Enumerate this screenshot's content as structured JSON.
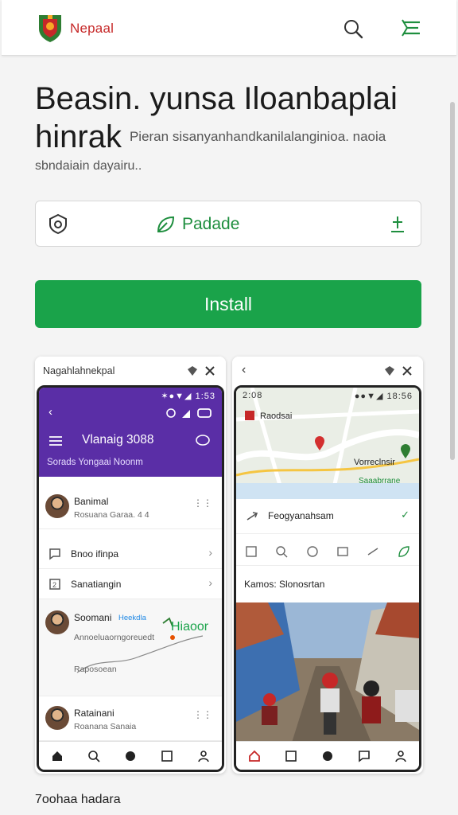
{
  "app": {
    "brand": "Nepaal",
    "logo_icon": "nepal-emblem-logo",
    "search_icon": "search-icon",
    "menu_icon": "menu-icon"
  },
  "heading": {
    "title_line1": "Beasin. yunsa Iloanbaplai",
    "title_line2": "hinrak",
    "inline_desc": "Pieran sisanyanhandkanilalanginioa. naoia",
    "subtitle": "sbndaiain dayairu.."
  },
  "update": {
    "label": "Padade",
    "left_icon": "shield-icon",
    "mid_icon": "leaf-icon",
    "right_icon": "download-icon"
  },
  "install": {
    "label": "Install"
  },
  "screenshots": [
    {
      "caption": "Nagahlahnekpal",
      "status": "✶●▼◢ 1:53",
      "header_title": "Vlanaig 3088",
      "tabs": "Sorads   Yongaai Noonm",
      "rows": [
        {
          "name": "Banimal",
          "sub": "Rosuana Garaa. 4 4"
        },
        {
          "name": "Bnoo ifinpa",
          "sub": ""
        },
        {
          "name": "Sanatiangin",
          "sub": ""
        },
        {
          "name": "Soomani",
          "sub": "Heekdla",
          "sub2": "Annoeluaorngoreuedt",
          "route_label": "Hiaoor",
          "sub3": "Raposoean"
        },
        {
          "name": "Ratainani",
          "sub": "Roanana Sanaia"
        }
      ]
    },
    {
      "caption": "",
      "status": "2:08",
      "status_r": "●●▼◢ 18:56",
      "map_label_1": "Raodsai",
      "map_label_2": "Vorreclnsir",
      "map_label_3": "Saaabrrane",
      "row1": "Feogyanahsam",
      "row2": "Kamos: Slonosrtan"
    }
  ],
  "footer": {
    "label": "7oohaa hadara"
  },
  "colors": {
    "accent_green": "#1aa34a",
    "brand_red": "#c62828",
    "purple": "#5a2ea6"
  }
}
